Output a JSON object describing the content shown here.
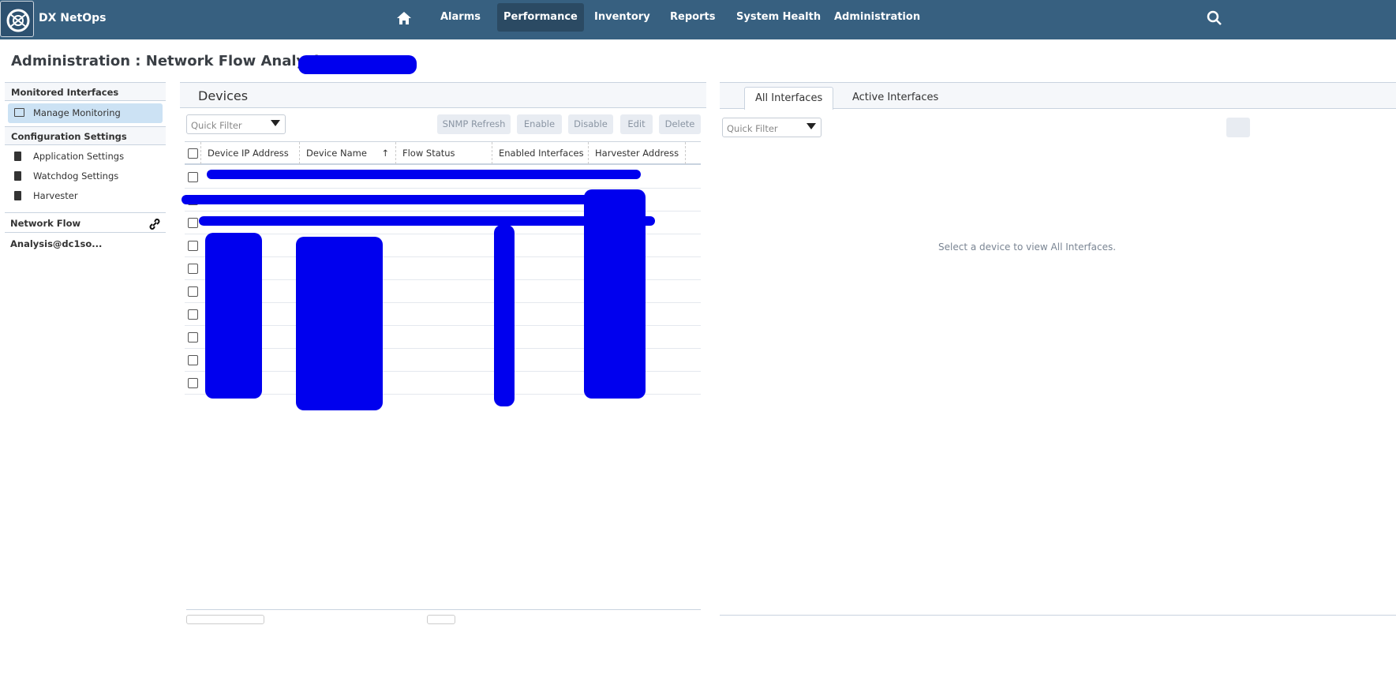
{
  "nav": {
    "brand": "DX NetOps",
    "items": [
      "Alarms",
      "Performance",
      "Inventory",
      "Reports",
      "System Health",
      "Administration"
    ],
    "active": "Performance",
    "accent": "#376080"
  },
  "page": {
    "title": "Administration : Network Flow Analysis@"
  },
  "sidebar": {
    "monitored_header": "Monitored Interfaces",
    "manage": "Manage Monitoring",
    "config_header": "Configuration Settings",
    "config_items": [
      "Application Settings",
      "Watchdog Settings",
      "Harvester"
    ],
    "nfa_link": "Network Flow Analysis@dc1so..."
  },
  "devices": {
    "title": "Devices",
    "filter_placeholder": "Quick Filter",
    "buttons": [
      "SNMP Refresh",
      "Enable",
      "Disable",
      "Edit",
      "Delete"
    ],
    "columns": [
      "Device IP Address",
      "Device Name",
      "Flow Status",
      "Enabled Interfaces",
      "Harvester Address"
    ],
    "row_count": 10
  },
  "interfaces": {
    "tabs": [
      "All Interfaces",
      "Active Interfaces"
    ],
    "filter_placeholder": "Quick Filter",
    "empty_message": "Select a device to view All Interfaces."
  }
}
